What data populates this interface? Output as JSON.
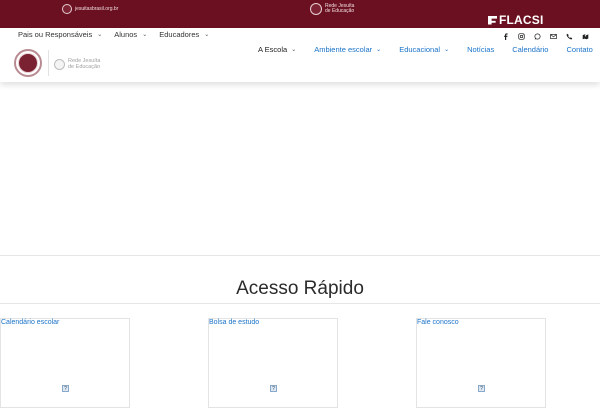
{
  "topbar": {
    "left_link": "jesuitasbrasil.org.br",
    "center_logo_line1": "Rede Jesuíta",
    "center_logo_line2": "de Educação",
    "right_logo": "FLACSI",
    "colors": {
      "background": "#6b1020"
    }
  },
  "header": {
    "subnav": [
      {
        "label": "Pais ou Responsáveis"
      },
      {
        "label": "Alunos"
      },
      {
        "label": "Educadores"
      }
    ],
    "logo_secondary_line1": "Rede Jesuíta",
    "logo_secondary_line2": "de Educação",
    "social_icons": [
      "facebook-icon",
      "instagram-icon",
      "whatsapp-icon",
      "email-icon",
      "phone-icon",
      "map-icon"
    ],
    "mainnav": [
      {
        "label": "A Escola",
        "dropdown": true
      },
      {
        "label": "Ambiente escolar",
        "dropdown": true
      },
      {
        "label": "Educacional",
        "dropdown": true
      },
      {
        "label": "Notícias",
        "dropdown": false
      },
      {
        "label": "Calendário",
        "dropdown": false
      },
      {
        "label": "Contato",
        "dropdown": false
      }
    ],
    "colors": {
      "accent": "#1a73c8"
    }
  },
  "quick_access": {
    "title": "Acesso Rápido",
    "cards": [
      {
        "label": "Calendário escolar"
      },
      {
        "label": "Bolsa de estudo"
      },
      {
        "label": "Fale conosco"
      }
    ]
  }
}
